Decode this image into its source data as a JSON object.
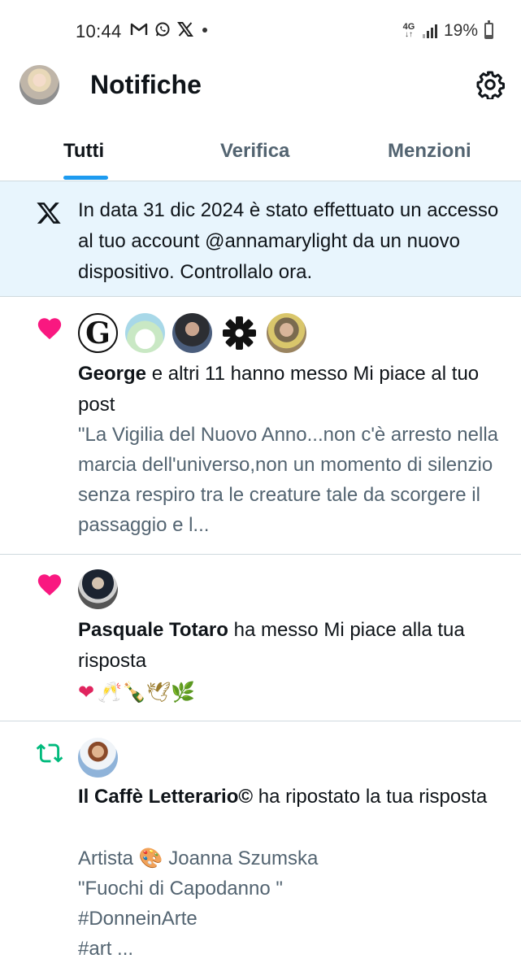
{
  "status_bar": {
    "time": "10:44",
    "app_icons": [
      "gmail-icon",
      "whatsapp-icon",
      "x-icon",
      "dot"
    ],
    "network": "4G",
    "battery": "19%"
  },
  "header": {
    "title": "Notifiche"
  },
  "tabs": [
    {
      "label": "Tutti",
      "active": true
    },
    {
      "label": "Verifica",
      "active": false
    },
    {
      "label": "Menzioni",
      "active": false
    }
  ],
  "banner": {
    "text": "In data 31 dic 2024 è stato effettuato un accesso al tuo account @annamarylight da un nuovo dispositivo. Controllalo ora."
  },
  "notifications": [
    {
      "kind": "like",
      "actor": "George",
      "action": " e altri 11 hanno messo Mi piace al tuo post",
      "quote": "\"La Vigilia del Nuovo Anno...non c'è arresto nella marcia dell'universo,non un momento di silenzio senza respiro tra le creature tale da scorgere il passaggio e l...",
      "avatar_g_letter": "G"
    },
    {
      "kind": "like",
      "actor": "Pasquale Totaro",
      "action": " ha messo Mi piace alla tua risposta",
      "emojis_heart": "❤",
      "emojis_rest": "🥂🍾🕊🌿"
    },
    {
      "kind": "repost",
      "actor": "Il Caffè Letterario©",
      "action": " ha ripostato la tua risposta",
      "quote_lines": [
        "Artista 🎨 Joanna Szumska",
        "\"Fuochi di Capodanno \"",
        "#DonneinArte",
        "#art ..."
      ]
    }
  ],
  "colors": {
    "accent": "#1d9bf0",
    "like": "#f91880",
    "repost": "#00ba7c",
    "banner_bg": "#e8f5fd",
    "secondary_text": "#536471"
  }
}
